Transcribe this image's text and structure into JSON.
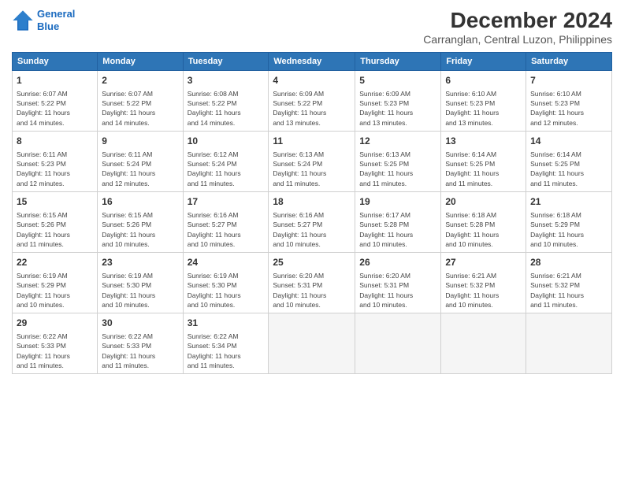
{
  "header": {
    "logo_line1": "General",
    "logo_line2": "Blue",
    "month_title": "December 2024",
    "subtitle": "Carranglan, Central Luzon, Philippines"
  },
  "weekdays": [
    "Sunday",
    "Monday",
    "Tuesday",
    "Wednesday",
    "Thursday",
    "Friday",
    "Saturday"
  ],
  "weeks": [
    [
      {
        "day": "1",
        "info": "Sunrise: 6:07 AM\nSunset: 5:22 PM\nDaylight: 11 hours\nand 14 minutes."
      },
      {
        "day": "2",
        "info": "Sunrise: 6:07 AM\nSunset: 5:22 PM\nDaylight: 11 hours\nand 14 minutes."
      },
      {
        "day": "3",
        "info": "Sunrise: 6:08 AM\nSunset: 5:22 PM\nDaylight: 11 hours\nand 14 minutes."
      },
      {
        "day": "4",
        "info": "Sunrise: 6:09 AM\nSunset: 5:22 PM\nDaylight: 11 hours\nand 13 minutes."
      },
      {
        "day": "5",
        "info": "Sunrise: 6:09 AM\nSunset: 5:23 PM\nDaylight: 11 hours\nand 13 minutes."
      },
      {
        "day": "6",
        "info": "Sunrise: 6:10 AM\nSunset: 5:23 PM\nDaylight: 11 hours\nand 13 minutes."
      },
      {
        "day": "7",
        "info": "Sunrise: 6:10 AM\nSunset: 5:23 PM\nDaylight: 11 hours\nand 12 minutes."
      }
    ],
    [
      {
        "day": "8",
        "info": "Sunrise: 6:11 AM\nSunset: 5:23 PM\nDaylight: 11 hours\nand 12 minutes."
      },
      {
        "day": "9",
        "info": "Sunrise: 6:11 AM\nSunset: 5:24 PM\nDaylight: 11 hours\nand 12 minutes."
      },
      {
        "day": "10",
        "info": "Sunrise: 6:12 AM\nSunset: 5:24 PM\nDaylight: 11 hours\nand 11 minutes."
      },
      {
        "day": "11",
        "info": "Sunrise: 6:13 AM\nSunset: 5:24 PM\nDaylight: 11 hours\nand 11 minutes."
      },
      {
        "day": "12",
        "info": "Sunrise: 6:13 AM\nSunset: 5:25 PM\nDaylight: 11 hours\nand 11 minutes."
      },
      {
        "day": "13",
        "info": "Sunrise: 6:14 AM\nSunset: 5:25 PM\nDaylight: 11 hours\nand 11 minutes."
      },
      {
        "day": "14",
        "info": "Sunrise: 6:14 AM\nSunset: 5:25 PM\nDaylight: 11 hours\nand 11 minutes."
      }
    ],
    [
      {
        "day": "15",
        "info": "Sunrise: 6:15 AM\nSunset: 5:26 PM\nDaylight: 11 hours\nand 11 minutes."
      },
      {
        "day": "16",
        "info": "Sunrise: 6:15 AM\nSunset: 5:26 PM\nDaylight: 11 hours\nand 10 minutes."
      },
      {
        "day": "17",
        "info": "Sunrise: 6:16 AM\nSunset: 5:27 PM\nDaylight: 11 hours\nand 10 minutes."
      },
      {
        "day": "18",
        "info": "Sunrise: 6:16 AM\nSunset: 5:27 PM\nDaylight: 11 hours\nand 10 minutes."
      },
      {
        "day": "19",
        "info": "Sunrise: 6:17 AM\nSunset: 5:28 PM\nDaylight: 11 hours\nand 10 minutes."
      },
      {
        "day": "20",
        "info": "Sunrise: 6:18 AM\nSunset: 5:28 PM\nDaylight: 11 hours\nand 10 minutes."
      },
      {
        "day": "21",
        "info": "Sunrise: 6:18 AM\nSunset: 5:29 PM\nDaylight: 11 hours\nand 10 minutes."
      }
    ],
    [
      {
        "day": "22",
        "info": "Sunrise: 6:19 AM\nSunset: 5:29 PM\nDaylight: 11 hours\nand 10 minutes."
      },
      {
        "day": "23",
        "info": "Sunrise: 6:19 AM\nSunset: 5:30 PM\nDaylight: 11 hours\nand 10 minutes."
      },
      {
        "day": "24",
        "info": "Sunrise: 6:19 AM\nSunset: 5:30 PM\nDaylight: 11 hours\nand 10 minutes."
      },
      {
        "day": "25",
        "info": "Sunrise: 6:20 AM\nSunset: 5:31 PM\nDaylight: 11 hours\nand 10 minutes."
      },
      {
        "day": "26",
        "info": "Sunrise: 6:20 AM\nSunset: 5:31 PM\nDaylight: 11 hours\nand 10 minutes."
      },
      {
        "day": "27",
        "info": "Sunrise: 6:21 AM\nSunset: 5:32 PM\nDaylight: 11 hours\nand 10 minutes."
      },
      {
        "day": "28",
        "info": "Sunrise: 6:21 AM\nSunset: 5:32 PM\nDaylight: 11 hours\nand 11 minutes."
      }
    ],
    [
      {
        "day": "29",
        "info": "Sunrise: 6:22 AM\nSunset: 5:33 PM\nDaylight: 11 hours\nand 11 minutes."
      },
      {
        "day": "30",
        "info": "Sunrise: 6:22 AM\nSunset: 5:33 PM\nDaylight: 11 hours\nand 11 minutes."
      },
      {
        "day": "31",
        "info": "Sunrise: 6:22 AM\nSunset: 5:34 PM\nDaylight: 11 hours\nand 11 minutes."
      },
      {
        "day": "",
        "info": ""
      },
      {
        "day": "",
        "info": ""
      },
      {
        "day": "",
        "info": ""
      },
      {
        "day": "",
        "info": ""
      }
    ]
  ]
}
